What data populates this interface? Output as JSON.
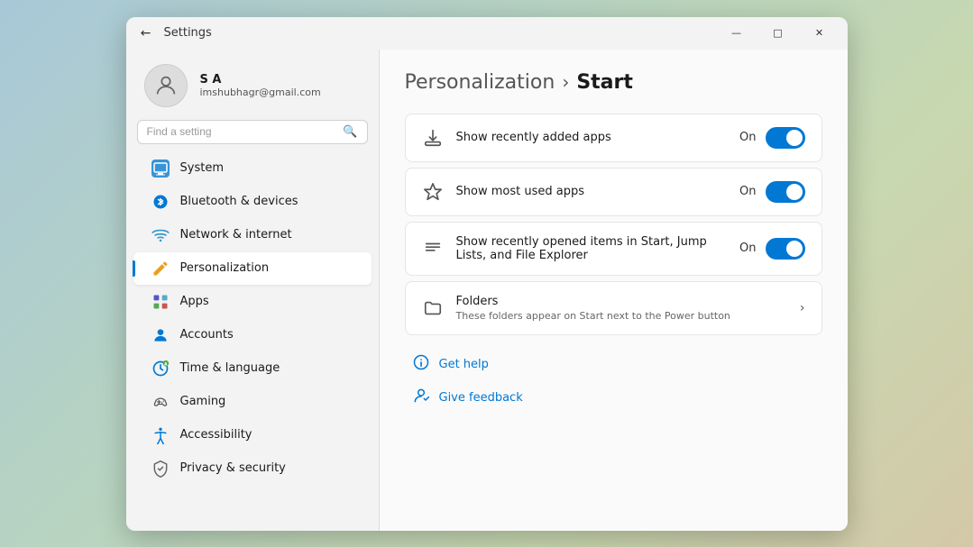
{
  "window": {
    "title": "Settings",
    "back_label": "←",
    "minimize_label": "—",
    "maximize_label": "□",
    "close_label": "✕"
  },
  "user": {
    "name": "S A",
    "email": "imshubhagr@gmail.com"
  },
  "search": {
    "placeholder": "Find a setting"
  },
  "nav": {
    "items": [
      {
        "id": "system",
        "label": "System",
        "icon": "🖥"
      },
      {
        "id": "bluetooth",
        "label": "Bluetooth & devices",
        "icon": "🔵"
      },
      {
        "id": "network",
        "label": "Network & internet",
        "icon": "📶"
      },
      {
        "id": "personalization",
        "label": "Personalization",
        "icon": "✏️",
        "active": true
      },
      {
        "id": "apps",
        "label": "Apps",
        "icon": "📦"
      },
      {
        "id": "accounts",
        "label": "Accounts",
        "icon": "👤"
      },
      {
        "id": "time",
        "label": "Time & language",
        "icon": "🌐"
      },
      {
        "id": "gaming",
        "label": "Gaming",
        "icon": "🎮"
      },
      {
        "id": "accessibility",
        "label": "Accessibility",
        "icon": "♿"
      },
      {
        "id": "privacy",
        "label": "Privacy & security",
        "icon": "🛡"
      }
    ]
  },
  "breadcrumb": {
    "parent": "Personalization",
    "separator": "›",
    "current": "Start"
  },
  "settings": [
    {
      "id": "recently-added",
      "icon": "⬇",
      "label": "Show recently added apps",
      "desc": "",
      "status": "On",
      "toggled": true,
      "has_chevron": false
    },
    {
      "id": "most-used",
      "icon": "☆",
      "label": "Show most used apps",
      "desc": "",
      "status": "On",
      "toggled": true,
      "has_chevron": false
    },
    {
      "id": "recently-opened",
      "icon": "≡",
      "label": "Show recently opened items in Start, Jump Lists, and File Explorer",
      "desc": "",
      "status": "On",
      "toggled": true,
      "has_chevron": false
    },
    {
      "id": "folders",
      "icon": "📁",
      "label": "Folders",
      "desc": "These folders appear on Start next to the Power button",
      "status": "",
      "toggled": false,
      "has_chevron": true
    }
  ],
  "help": {
    "get_help_label": "Get help",
    "feedback_label": "Give feedback",
    "get_help_icon": "❓",
    "feedback_icon": "👤"
  }
}
